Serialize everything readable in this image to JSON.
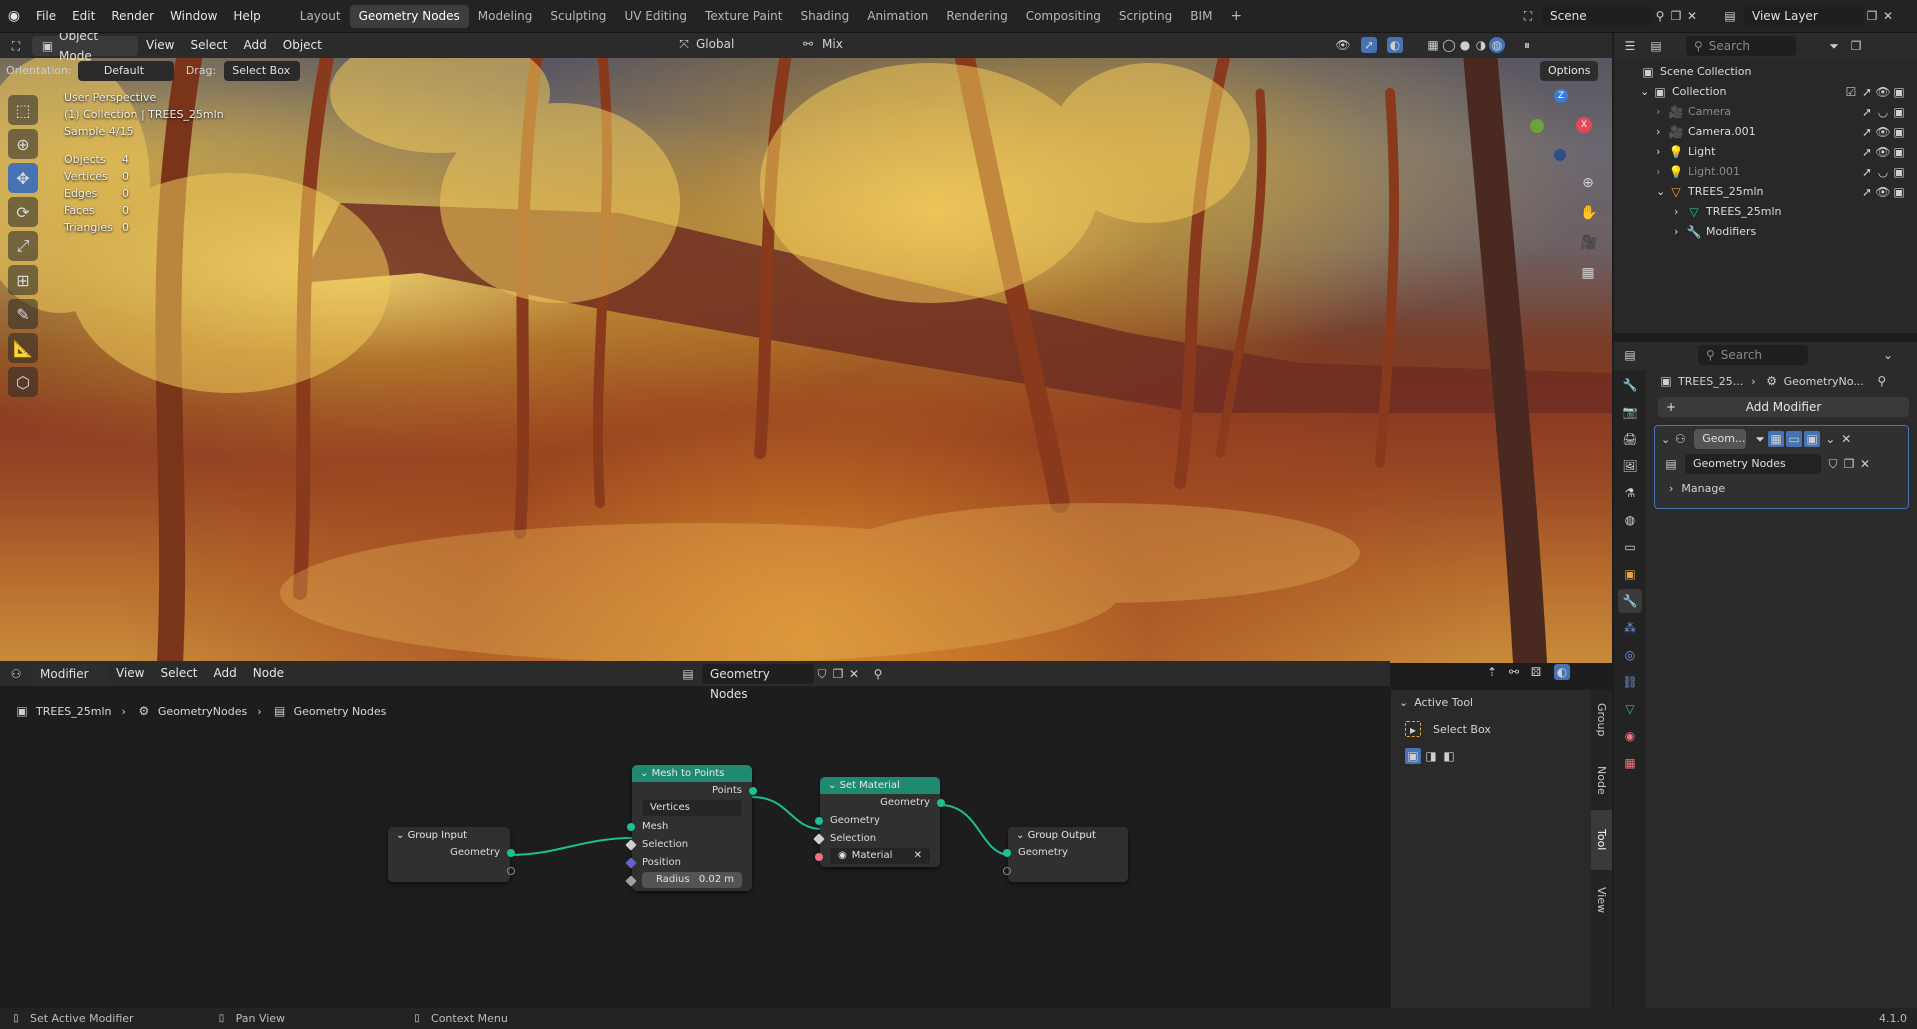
{
  "app": {
    "version": "4.1.0"
  },
  "menus": [
    "File",
    "Edit",
    "Render",
    "Window",
    "Help"
  ],
  "workspaces": [
    "Layout",
    "Geometry Nodes",
    "Modeling",
    "Sculpting",
    "UV Editing",
    "Texture Paint",
    "Shading",
    "Animation",
    "Rendering",
    "Compositing",
    "Scripting",
    "BIM"
  ],
  "active_workspace": "Geometry Nodes",
  "scene": {
    "name": "Scene",
    "view_layer": "View Layer"
  },
  "viewport": {
    "mode": "Object Mode",
    "menus": [
      "View",
      "Select",
      "Add",
      "Object"
    ],
    "transform_orientation": "Global",
    "pivot": "Mix",
    "orientation_label": "Orientation:",
    "orientation_value": "Default",
    "drag_label": "Drag:",
    "drag_value": "Select Box",
    "options": "Options",
    "overlay": {
      "line1": "User Perspective",
      "line2": "(1) Collection | TREES_25mln",
      "line3": "Sample 4/15"
    },
    "stats": [
      {
        "label": "Objects",
        "value": "4"
      },
      {
        "label": "Vertices",
        "value": "0"
      },
      {
        "label": "Edges",
        "value": "0"
      },
      {
        "label": "Faces",
        "value": "0"
      },
      {
        "label": "Triangles",
        "value": "0"
      }
    ],
    "gizmo": {
      "x_color": "#e84855",
      "y_color": "#6ca33a",
      "z_color": "#3e7bd6"
    }
  },
  "node_editor": {
    "type": "Modifier",
    "menus": [
      "View",
      "Select",
      "Add",
      "Node"
    ],
    "node_group": "Geometry Nodes",
    "breadcrumb": [
      "TREES_25mln",
      "GeometryNodes",
      "Geometry Nodes"
    ],
    "nodes": {
      "group_input": {
        "title": "Group Input",
        "out": "Geometry"
      },
      "mesh_to_points": {
        "title": "Mesh to Points",
        "out": "Points",
        "mode": "Vertices",
        "in_mesh": "Mesh",
        "in_selection": "Selection",
        "in_position": "Position",
        "radius_label": "Radius",
        "radius_value": "0.02 m"
      },
      "set_material": {
        "title": "Set Material",
        "out": "Geometry",
        "in_geometry": "Geometry",
        "in_selection": "Selection",
        "material": "Material"
      },
      "group_output": {
        "title": "Group Output",
        "in": "Geometry"
      }
    },
    "side_panel": {
      "header": "Active Tool",
      "tool": "Select Box",
      "tabs": [
        "Group",
        "Node",
        "Tool",
        "View"
      ],
      "active_tab": "Tool"
    },
    "header_color": "#1f8a70"
  },
  "outliner": {
    "search_placeholder": "Search",
    "root": "Scene Collection",
    "items": [
      {
        "label": "Collection"
      },
      {
        "label": "Camera"
      },
      {
        "label": "Camera.001"
      },
      {
        "label": "Light"
      },
      {
        "label": "Light.001"
      },
      {
        "label": "TREES_25mln"
      },
      {
        "label": "TREES_25mln"
      },
      {
        "label": "Modifiers"
      }
    ]
  },
  "properties": {
    "search_placeholder": "Search",
    "breadcrumb_object": "TREES_25...",
    "breadcrumb_modifier": "GeometryNo...",
    "add_modifier": "Add Modifier",
    "modifier_name": "Geom...",
    "node_group": "Geometry Nodes",
    "manage": "Manage"
  },
  "status": {
    "left": "Set Active Modifier",
    "middle": "Pan View",
    "right": "Context Menu"
  }
}
